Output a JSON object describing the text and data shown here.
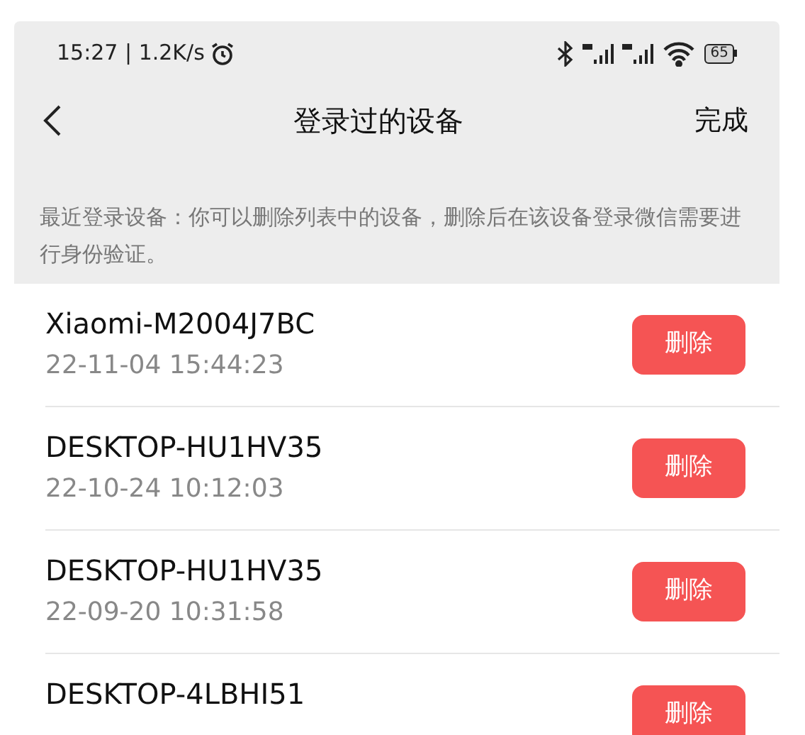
{
  "status_bar": {
    "time": "15:27 | 1.2K/s",
    "battery": "65"
  },
  "nav": {
    "title": "登录过的设备",
    "action": "完成"
  },
  "notice": "最近登录设备：你可以删除列表中的设备，删除后在该设备登录微信需要进行身份验证。",
  "devices": [
    {
      "name": "Xiaomi-M2004J7BC",
      "time": "22-11-04 15:44:23",
      "button": "删除"
    },
    {
      "name": "DESKTOP-HU1HV35",
      "time": "22-10-24 10:12:03",
      "button": "删除"
    },
    {
      "name": "DESKTOP-HU1HV35",
      "time": "22-09-20 10:31:58",
      "button": "删除"
    },
    {
      "name": "DESKTOP-4LBHI51",
      "button": "删除"
    }
  ]
}
